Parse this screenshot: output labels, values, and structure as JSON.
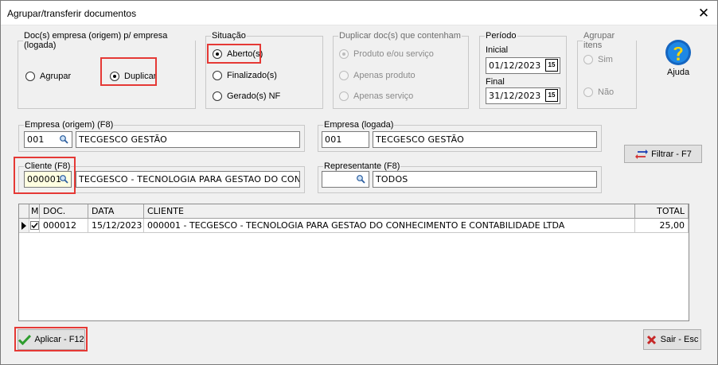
{
  "window": {
    "title": "Agrupar/transferir documentos",
    "close_glyph": "✕"
  },
  "doc_empresa": {
    "legend": "Doc(s) empresa (origem) p/ empresa (logada)",
    "agrupar_label": "Agrupar",
    "duplicar_label": "Duplicar",
    "selected": "Duplicar"
  },
  "situacao": {
    "legend": "Situação",
    "options": [
      "Aberto(s)",
      "Finalizado(s)",
      "Gerado(s) NF"
    ],
    "selected": "Aberto(s)"
  },
  "duplicar_docs": {
    "legend": "Duplicar doc(s) que contenham",
    "options": [
      "Produto e/ou serviço",
      "Apenas produto",
      "Apenas serviço"
    ],
    "selected": "Produto e/ou serviço"
  },
  "periodo": {
    "legend": "Período",
    "inicial_label": "Inicial",
    "inicial_value": "01/12/2023",
    "final_label": "Final",
    "final_value": "31/12/2023",
    "calendar_glyph": "15"
  },
  "agrupar_itens": {
    "legend": "Agrupar itens",
    "sim_label": "Sim",
    "nao_label": "Não"
  },
  "ajuda": {
    "label": "Ajuda",
    "icon": "help-icon"
  },
  "empresa_origem": {
    "legend": "Empresa (origem) (F8)",
    "code": "001",
    "name": "TECGESCO GESTÃO"
  },
  "empresa_logada": {
    "legend": "Empresa (logada)",
    "code": "001",
    "name": "TECGESCO GESTÃO"
  },
  "cliente": {
    "legend": "Cliente (F8)",
    "code": "000001",
    "name": "TECGESCO - TECNOLOGIA PARA GESTAO DO CONHECIMENTO E CONTABILIDADE LTDA"
  },
  "representante": {
    "legend": "Representante (F8)",
    "code": "",
    "name": "TODOS"
  },
  "filtrar": {
    "label": "Filtrar - F7"
  },
  "grid": {
    "columns": [
      "M",
      "DOC.",
      "DATA",
      "CLIENTE",
      "TOTAL"
    ],
    "rows": [
      {
        "marked": true,
        "doc": "000012",
        "data": "15/12/2023",
        "cliente": "000001 - TECGESCO - TECNOLOGIA PARA GESTAO DO CONHECIMENTO E CONTABILIDADE LTDA",
        "total": "25,00"
      }
    ]
  },
  "aplicar": {
    "label": "Aplicar - F12"
  },
  "sair": {
    "label": "Sair - Esc"
  },
  "colors": {
    "highlight": "#e53935",
    "field_yellow": "#ffffe1",
    "help_blue": "#1565c0",
    "help_yellow": "#ffd600"
  }
}
